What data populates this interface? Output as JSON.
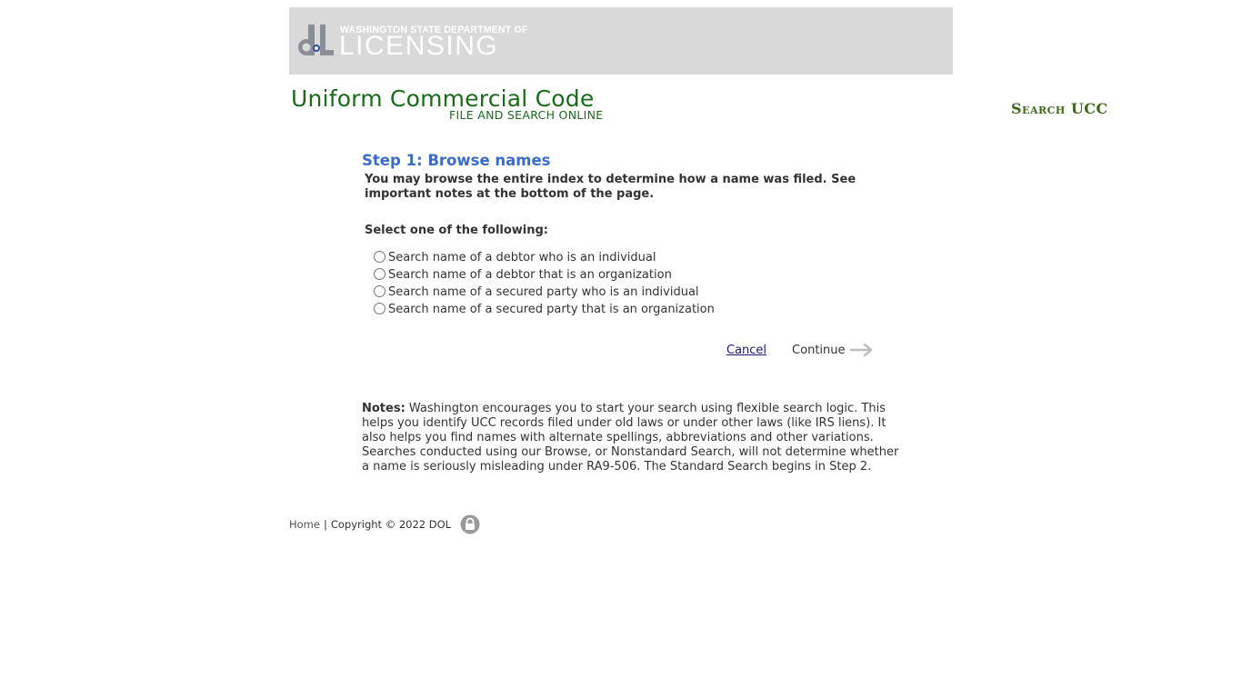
{
  "header": {
    "logo_small": "WASHINGTON STATE DEPARTMENT OF",
    "logo_big": "LICENSING",
    "logo_mark": "dL"
  },
  "ucc": {
    "title": "Uniform Commercial Code",
    "subtitle": "FILE AND SEARCH ONLINE",
    "nav_search": "Search UCC"
  },
  "step": {
    "title": "Step 1: Browse names",
    "description": "You may browse the entire index to determine how a name was filed. See important notes at the bottom of the page.",
    "select_label": "Select one of the following:",
    "options": [
      {
        "label": "Search name of a debtor who is an individual"
      },
      {
        "label": "Search name of a debtor that is an organization"
      },
      {
        "label": "Search name of a secured party who is an individual"
      },
      {
        "label": "Search name of a secured party that is an organization"
      }
    ]
  },
  "actions": {
    "cancel": "Cancel",
    "continue": "Continue"
  },
  "notes": {
    "heading": "Notes:",
    "text": " Washington encourages you to start your search using flexible search logic. This helps you identify UCC records filed under old laws or under other laws (like IRS liens). It also helps you find names with alternate spellings, abbreviations and other variations. Searches conducted using our Browse, or Nonstandard Search, will not determine whether a name is seriously misleading under RA9-506. The Standard Search begins in Step 2."
  },
  "footer": {
    "home": "Home",
    "separator": "|",
    "copyright": "Copyright © 2022 DOL"
  },
  "icons": {
    "continue_arrow": "arrow-right-icon",
    "lock": "lock-icon"
  },
  "colors": {
    "banner_bg": "#d9d9d9",
    "ucc_green": "#1a6b1a",
    "step_blue": "#3a6ccb"
  }
}
